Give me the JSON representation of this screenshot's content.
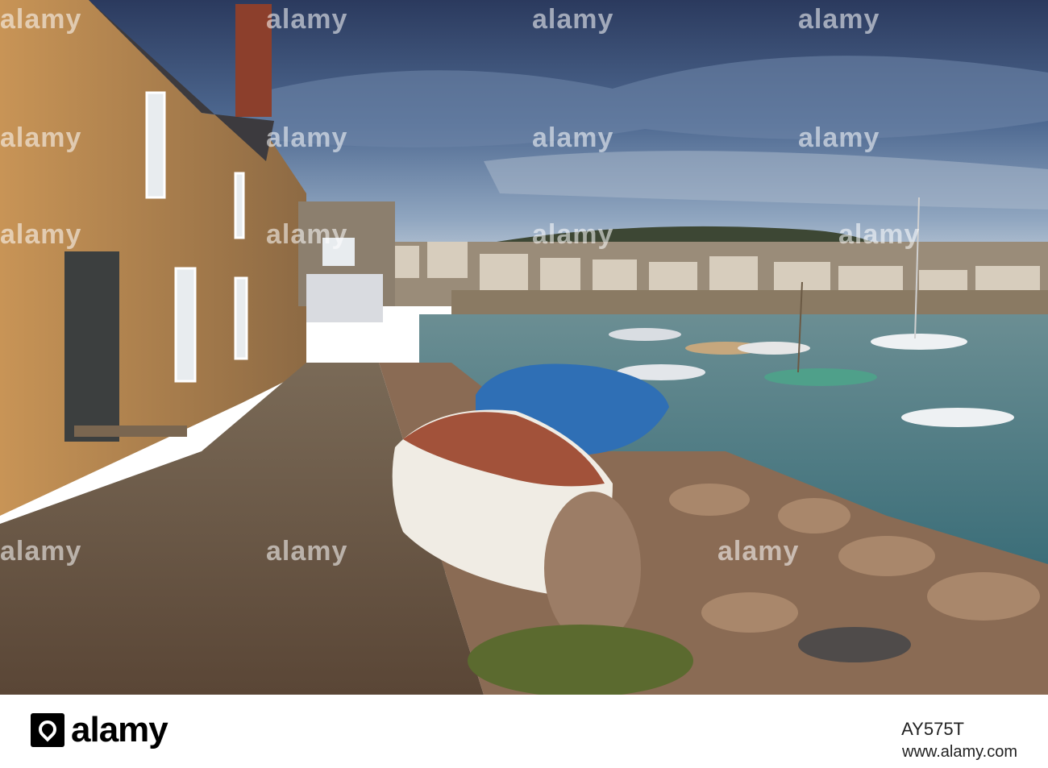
{
  "photo": {
    "description_icon": "harbour-photo",
    "colors": {
      "sky_top": "#2f3f63",
      "sky_mid": "#5a7397",
      "sky_light": "#c9d2de",
      "water": "#4f7e86",
      "stone": "#b8854a",
      "path": "#6d5a47",
      "tarp": "#2f6fb5"
    }
  },
  "watermark": {
    "text": "alamy"
  },
  "footer": {
    "logo_text": "alamy",
    "image_id": "AY575T",
    "site": "www.alamy.com"
  }
}
